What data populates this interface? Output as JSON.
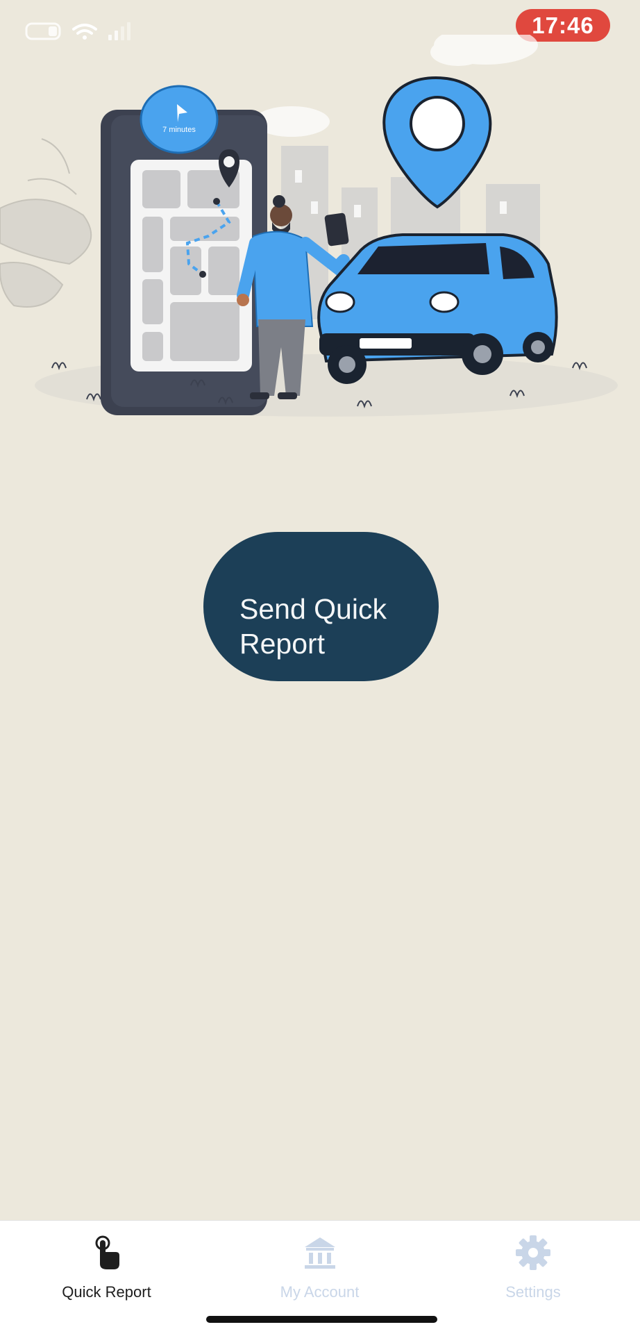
{
  "status_bar": {
    "time": "17:46",
    "icons": [
      "battery-icon",
      "wifi-icon",
      "signal-icon"
    ]
  },
  "hero": {
    "illustration": "navigation-map-person-car",
    "bubble_text": "7 minutes"
  },
  "main": {
    "quick_report_button": {
      "line1": "Send Quick",
      "line2": "Report"
    }
  },
  "tab_bar": {
    "tabs": [
      {
        "label": "Quick Report",
        "icon": "pointer-hand-icon",
        "active": true
      },
      {
        "label": "My Account",
        "icon": "bank-icon",
        "active": false
      },
      {
        "label": "Settings",
        "icon": "gear-icon",
        "active": false
      }
    ]
  },
  "colors": {
    "background": "#ECE8DC",
    "button": "#1C3F57",
    "accent_blue": "#4AA3EE",
    "clock_badge": "#E0483E",
    "tab_inactive": "#C9D6E8"
  }
}
